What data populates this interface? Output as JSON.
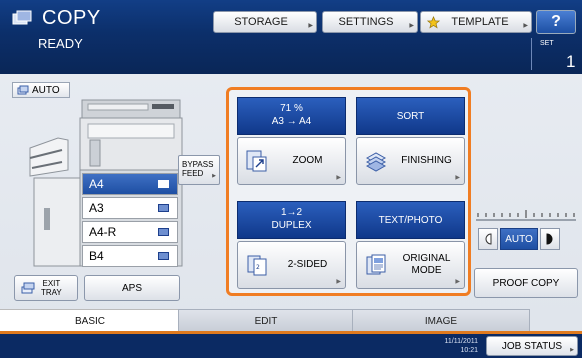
{
  "header": {
    "title": "COPY",
    "status": "READY",
    "buttons": {
      "storage": "STORAGE",
      "settings": "SETTINGS",
      "template": "TEMPLATE",
      "help": "?"
    },
    "set_label": "SET",
    "set_value": "1"
  },
  "paper": {
    "auto_label": "AUTO",
    "trays": [
      "A4",
      "A3",
      "A4-R",
      "B4"
    ],
    "selected_tray": "A4",
    "bypass_label_1": "BYPASS",
    "bypass_label_2": "FEED",
    "exit_tray_1": "EXIT",
    "exit_tray_2": "TRAY",
    "aps_label": "APS"
  },
  "functions": {
    "zoom": {
      "info_line1": "71 %",
      "info_line2": "A3  →  A4",
      "button": "ZOOM"
    },
    "finishing": {
      "info": "SORT",
      "button": "FINISHING"
    },
    "duplex": {
      "info_line1": "1→2",
      "info_line2": "DUPLEX",
      "button": "2-SIDED"
    },
    "original": {
      "info": "TEXT/PHOTO",
      "button_line1": "ORIGINAL",
      "button_line2": "MODE"
    }
  },
  "density": {
    "mode": "AUTO"
  },
  "proof_copy": "PROOF COPY",
  "tabs": [
    {
      "label": "BASIC",
      "active": true
    },
    {
      "label": "EDIT",
      "active": false
    },
    {
      "label": "IMAGE",
      "active": false
    }
  ],
  "status_bar": {
    "date": "11/11/2011",
    "time": "10:21",
    "job_status": "JOB STATUS"
  },
  "colors": {
    "accent": "#f07d23",
    "header": "#0c2f6a",
    "selected": "#2b5fbd"
  },
  "icons": [
    "copy-icon",
    "star-icon",
    "auto-paper-icon",
    "zoom-icon",
    "finishing-icon",
    "duplex-icon",
    "original-mode-icon",
    "exit-tray-icon",
    "tray-icon"
  ]
}
